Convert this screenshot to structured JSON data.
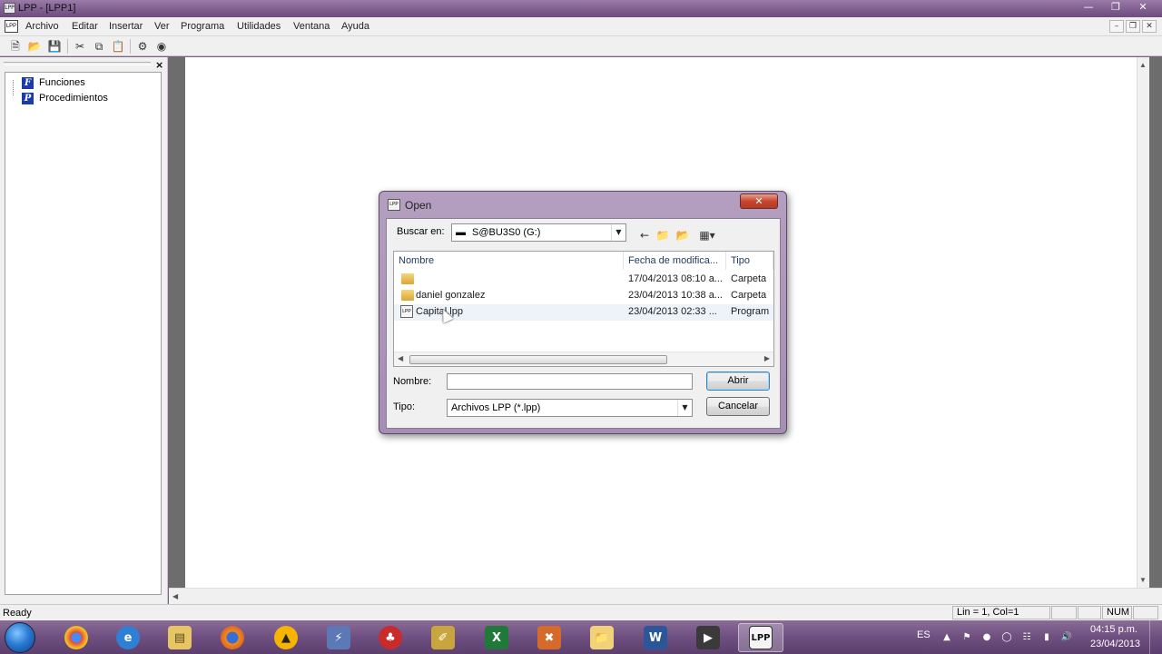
{
  "window": {
    "title": "LPP - [LPP1]",
    "controls": [
      "minimize",
      "restore",
      "close"
    ]
  },
  "menu": {
    "items": [
      "Archivo",
      "Editar",
      "Insertar",
      "Ver",
      "Programa",
      "Utilidades",
      "Ventana",
      "Ayuda"
    ]
  },
  "toolbar": {
    "icons": [
      "new-icon",
      "open-icon",
      "save-icon",
      "cut-icon",
      "copy-icon",
      "paste-icon",
      "compile-icon",
      "run-icon"
    ]
  },
  "tree": {
    "items": [
      {
        "icon": "F",
        "label": "Funciones"
      },
      {
        "icon": "P",
        "label": "Procedimientos"
      }
    ]
  },
  "status": {
    "ready": "Ready",
    "position": "Lin = 1, Col=1",
    "num": "NUM"
  },
  "dialog": {
    "title": "Open",
    "look_in_label": "Buscar en:",
    "look_in_value": "S@BU3S0 (G:)",
    "columns": [
      "Nombre",
      "Fecha de modifica...",
      "Tipo"
    ],
    "files": [
      {
        "name": "",
        "date": "17/04/2013 08:10 a...",
        "type": "Carpeta",
        "kind": "folder"
      },
      {
        "name": "daniel gonzalez",
        "date": "23/04/2013 10:38 a...",
        "type": "Carpeta",
        "kind": "folder"
      },
      {
        "name": "Capital.lpp",
        "date": "23/04/2013 02:33 ...",
        "type": "Program",
        "kind": "file"
      }
    ],
    "name_label": "Nombre:",
    "name_value": "",
    "type_label": "Tipo:",
    "type_value": "Archivos LPP (*.lpp)",
    "open_button": "Abrir",
    "cancel_button": "Cancelar"
  },
  "taskbar": {
    "apps": [
      "chrome-icon",
      "ie-icon",
      "explorer-icon",
      "firefox-icon",
      "avast-icon",
      "winamp-icon",
      "flash-icon",
      "paint-icon",
      "excel-icon",
      "tool-icon",
      "folder-icon",
      "word-icon",
      "media-icon",
      "lpp-icon"
    ],
    "lang": "ES",
    "time": "04:15 p.m.",
    "date": "23/04/2013"
  }
}
